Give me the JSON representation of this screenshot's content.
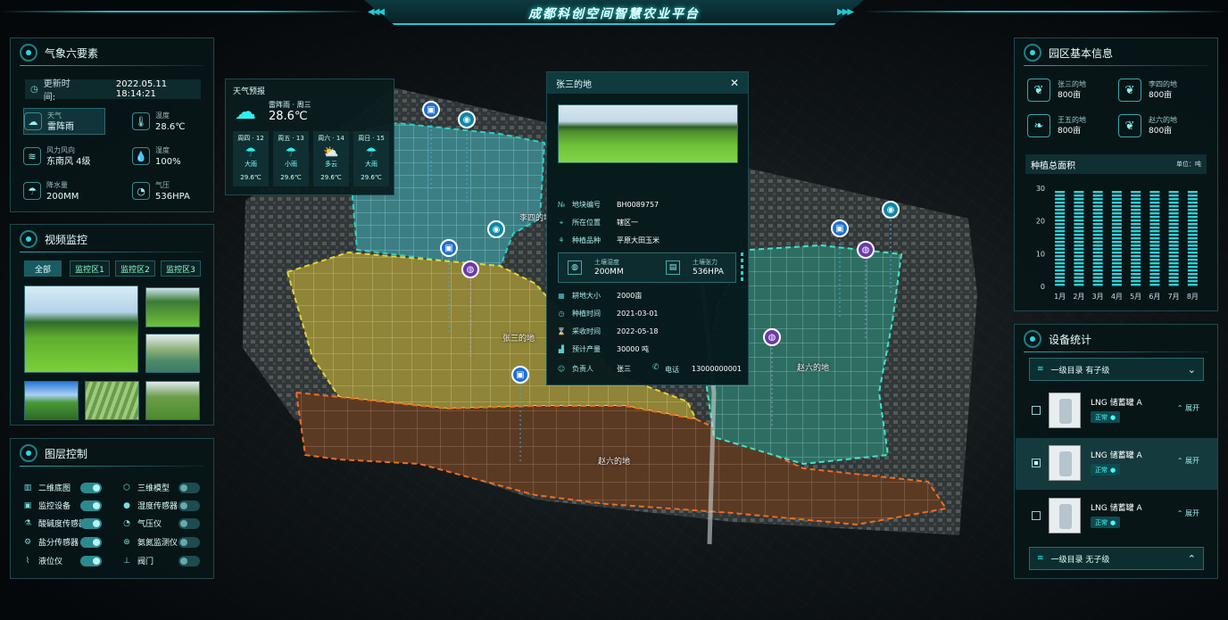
{
  "header": {
    "title": "成都科创空间智慧农业平台"
  },
  "weather": {
    "title": "气象六要素",
    "update_label": "更新时间:",
    "update_time": "2022.05.11 18:14:21",
    "items": [
      {
        "icon": "cloud-icon",
        "label": "天气",
        "value": "雷阵雨"
      },
      {
        "icon": "thermometer-icon",
        "label": "温度",
        "value": "28.6℃"
      },
      {
        "icon": "wind-icon",
        "label": "风力风向",
        "value": "东南风 4级"
      },
      {
        "icon": "droplet-icon",
        "label": "湿度",
        "value": "100%"
      },
      {
        "icon": "rain-icon",
        "label": "降水量",
        "value": "200MM"
      },
      {
        "icon": "gauge-icon",
        "label": "气压",
        "value": "536HPA"
      }
    ]
  },
  "video": {
    "title": "视频监控",
    "tabs": [
      "全部",
      "监控区1",
      "监控区2",
      "监控区3"
    ]
  },
  "layers": {
    "title": "图层控制",
    "items": [
      {
        "label": "二维底图",
        "on": true
      },
      {
        "label": "三维模型",
        "on": false
      },
      {
        "label": "监控设备",
        "on": true
      },
      {
        "label": "湿度传感器",
        "on": false
      },
      {
        "label": "酸碱度传感器",
        "on": true
      },
      {
        "label": "气压仪",
        "on": false
      },
      {
        "label": "盐分传感器",
        "on": true
      },
      {
        "label": "氨氮监测仪",
        "on": false
      },
      {
        "label": "液位仪",
        "on": true
      },
      {
        "label": "阀门",
        "on": false
      }
    ]
  },
  "forecast": {
    "title": "天气预报",
    "now_desc": "雷阵雨 · 周三",
    "now_temp": "28.6℃",
    "days": [
      {
        "day": "周四 · 12",
        "cond": "大雨",
        "temp": "29.6℃"
      },
      {
        "day": "周五 · 13",
        "cond": "小雨",
        "temp": "29.6℃"
      },
      {
        "day": "周六 · 14",
        "cond": "多云",
        "temp": "29.6℃"
      },
      {
        "day": "周日 · 15",
        "cond": "大雨",
        "temp": "29.6℃"
      }
    ]
  },
  "plot_info": {
    "title": "张三的地",
    "rows1": [
      {
        "label": "地块编号",
        "value": "BH0089757"
      },
      {
        "label": "所在位置",
        "value": "辖区一"
      },
      {
        "label": "种植品种",
        "value": "平原大田玉米"
      }
    ],
    "soil": [
      {
        "label": "土壤湿度",
        "value": "200MM"
      },
      {
        "label": "土壤张力",
        "value": "536HPA"
      }
    ],
    "rows2": [
      {
        "label": "耕地大小",
        "value": "2000亩"
      },
      {
        "label": "种植时间",
        "value": "2021-03-01"
      },
      {
        "label": "采收时间",
        "value": "2022-05-18"
      },
      {
        "label": "预计产量",
        "value": "30000 吨"
      }
    ],
    "owner_label": "负责人",
    "owner": "张三",
    "phone_label": "电话",
    "phone": "13000000001"
  },
  "map_labels": [
    "李四的地",
    "张三的地",
    "赵六的地",
    "赵六的地"
  ],
  "park": {
    "title": "园区基本信息",
    "items": [
      {
        "name": "张三的地",
        "area": "800亩"
      },
      {
        "name": "李四的地",
        "area": "800亩"
      },
      {
        "name": "王五的地",
        "area": "800亩"
      },
      {
        "name": "赵六的地",
        "area": "800亩"
      }
    ],
    "chart_title": "种植总面积",
    "unit": "单位：吨"
  },
  "chart_data": {
    "type": "bar",
    "title": "种植总面积",
    "ylabel": "单位：吨",
    "categories": [
      "1月",
      "2月",
      "3月",
      "4月",
      "5月",
      "6月",
      "7月",
      "8月"
    ],
    "values": [
      29.8,
      29.8,
      29.8,
      29.8,
      29.8,
      29.8,
      29.8,
      29.8
    ],
    "ylim": [
      0,
      30
    ],
    "yticks": [
      0,
      10,
      20,
      30
    ]
  },
  "devices": {
    "title": "设备统计",
    "cat1": "一级目录 有子级",
    "cat2": "一级目录 无子级",
    "items": [
      {
        "name": "LNG 储蓄罐 A",
        "status": "正常",
        "expand": "展开",
        "selected": false
      },
      {
        "name": "LNG 储蓄罐 A",
        "status": "正常",
        "expand": "展开",
        "selected": true
      },
      {
        "name": "LNG 储蓄罐 A",
        "status": "正常",
        "expand": "展开",
        "selected": false
      }
    ]
  },
  "colors": {
    "accent": "#23c7d6",
    "bar": "#2fd0d8",
    "plot_yellow": "#d8c24a",
    "plot_orange": "#e36a1a",
    "plot_cyan": "#27d3c5",
    "plot_green": "#3fe0b0"
  }
}
